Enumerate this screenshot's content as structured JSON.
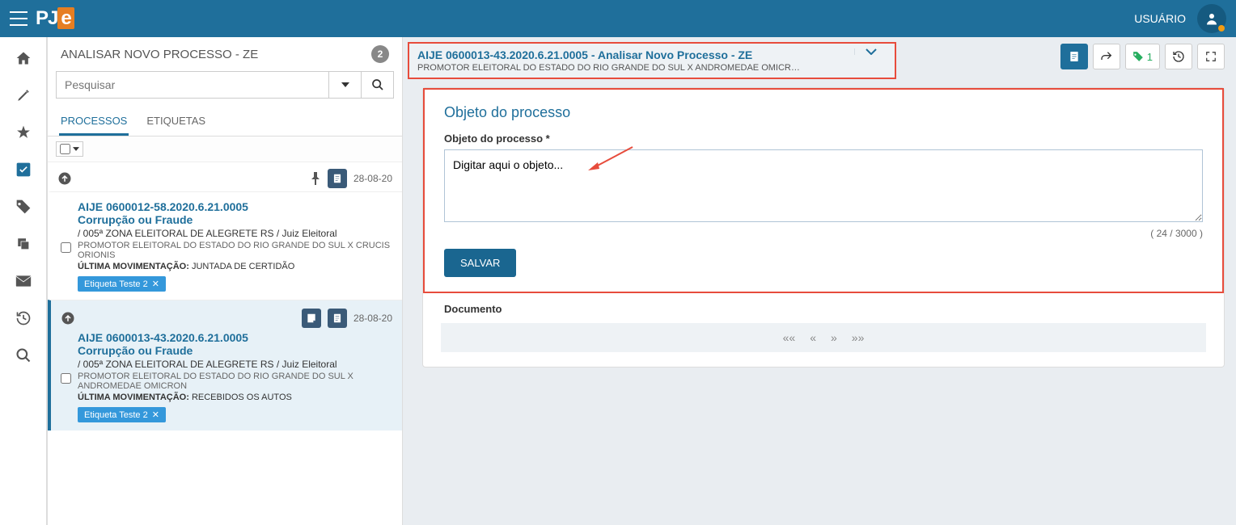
{
  "topbar": {
    "user_label": "USUÁRIO",
    "logo_p": "P",
    "logo_j": "J",
    "logo_e": "e"
  },
  "panel": {
    "title": "ANALISAR NOVO PROCESSO - ZE",
    "count": "2",
    "search_placeholder": "Pesquisar",
    "tabs": {
      "processos": "PROCESSOS",
      "etiquetas": "ETIQUETAS"
    }
  },
  "cases": [
    {
      "date": "28-08-20",
      "number": "AIJE 0600012-58.2020.6.21.0005",
      "subject": "Corrupção ou Fraude",
      "zone": "/ 005ª ZONA ELEITORAL DE ALEGRETE RS / Juiz Eleitoral",
      "parties": "PROMOTOR ELEITORAL DO ESTADO DO RIO GRANDE DO SUL X CRUCIS ORIONIS",
      "mov_label": "ÚLTIMA MOVIMENTAÇÃO:",
      "mov_value": "JUNTADA DE CERTIDÃO",
      "etiqueta": "Etiqueta Teste 2",
      "has_pin": true
    },
    {
      "date": "28-08-20",
      "number": "AIJE 0600013-43.2020.6.21.0005",
      "subject": "Corrupção ou Fraude",
      "zone": "/ 005ª ZONA ELEITORAL DE ALEGRETE RS / Juiz Eleitoral",
      "parties": "PROMOTOR ELEITORAL DO ESTADO DO RIO GRANDE DO SUL X ANDROMEDAE OMICRON",
      "mov_label": "ÚLTIMA MOVIMENTAÇÃO:",
      "mov_value": "RECEBIDOS OS AUTOS",
      "etiqueta": "Etiqueta Teste 2",
      "has_pin": false
    }
  ],
  "process": {
    "title": "AIJE 0600013-43.2020.6.21.0005 - Analisar Novo Processo - ZE",
    "subtitle": "PROMOTOR ELEITORAL DO ESTADO DO RIO GRANDE DO SUL X ANDROMEDAE OMICR…",
    "tag_count": "1"
  },
  "objeto": {
    "section_title": "Objeto do processo",
    "field_label": "Objeto do processo *",
    "textarea_value": "Digitar aqui o objeto...",
    "char_count": "( 24 / 3000 )",
    "save_label": "SALVAR"
  },
  "documento": {
    "title": "Documento",
    "pager": {
      "first": "««",
      "prev": "«",
      "next": "»",
      "last": "»»"
    }
  }
}
